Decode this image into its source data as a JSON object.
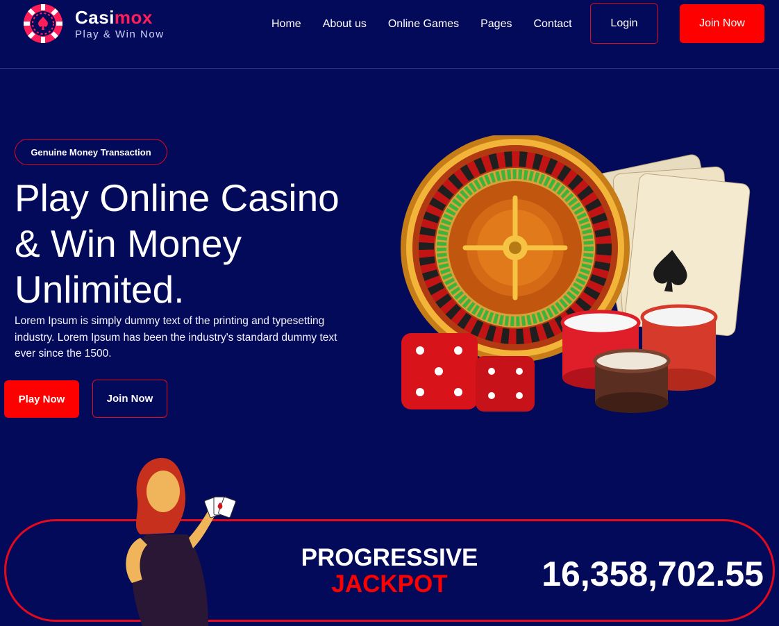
{
  "brand": {
    "name_part1": "Casi",
    "name_part2": "mox",
    "tagline": "Play & Win Now"
  },
  "nav": {
    "items": [
      "Home",
      "About us",
      "Online Games",
      "Pages",
      "Contact"
    ],
    "login_label": "Login",
    "join_label": "Join Now"
  },
  "hero": {
    "badge": "Genuine Money Transaction",
    "title_line1": "Play Online Casino",
    "title_line2": "& Win Money",
    "title_line3": "Unlimited.",
    "description": "Lorem Ipsum is simply dummy text of the printing and typesetting industry. Lorem Ipsum has been the industry's standard dummy text ever since the 1500.",
    "play_label": "Play Now",
    "join_label": "Join Now"
  },
  "jackpot": {
    "line1": "PROGRESSIVE",
    "line2": "JACKPOT",
    "amount": "16,358,702.55"
  },
  "colors": {
    "background": "#040a5a",
    "accent": "#ff0000",
    "brand_pink": "#ff1e5a"
  }
}
